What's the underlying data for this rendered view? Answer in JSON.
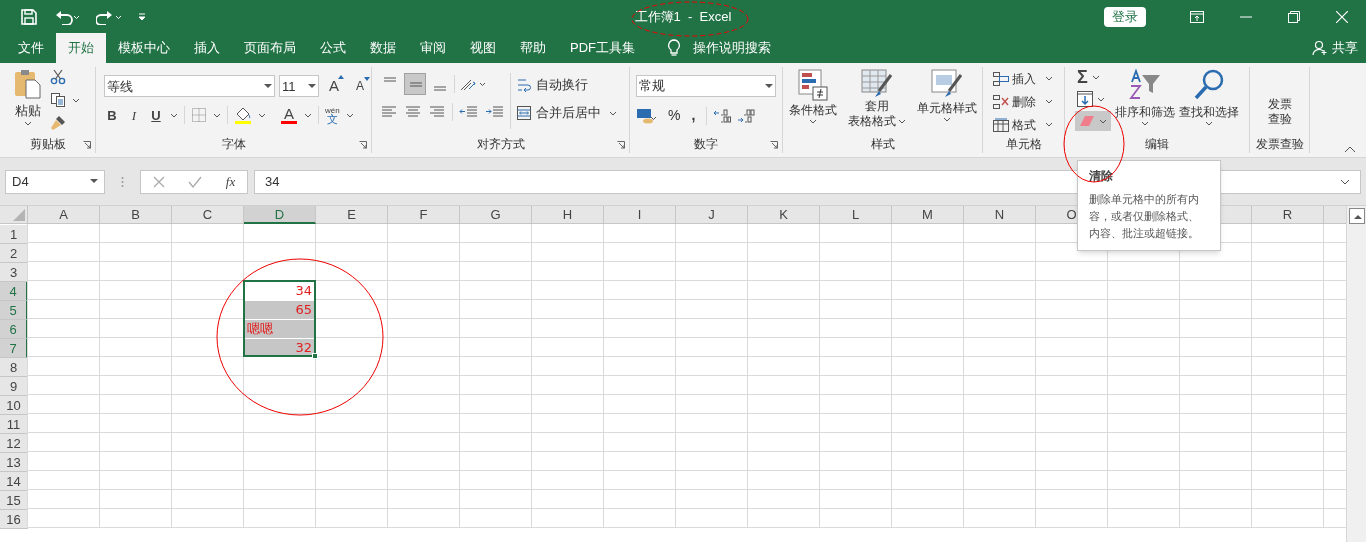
{
  "window": {
    "title": "工作簿1  -  Excel",
    "sign_in": "登录"
  },
  "tabs": [
    {
      "label": "文件",
      "selected": false
    },
    {
      "label": "开始",
      "selected": true
    },
    {
      "label": "模板中心",
      "selected": false
    },
    {
      "label": "插入",
      "selected": false
    },
    {
      "label": "页面布局",
      "selected": false
    },
    {
      "label": "公式",
      "selected": false
    },
    {
      "label": "数据",
      "selected": false
    },
    {
      "label": "审阅",
      "selected": false
    },
    {
      "label": "视图",
      "selected": false
    },
    {
      "label": "帮助",
      "selected": false
    },
    {
      "label": "PDF工具集",
      "selected": false
    }
  ],
  "tell_me": "操作说明搜索",
  "share": "共享",
  "ribbon": {
    "clipboard": {
      "paste": "粘贴",
      "label": "剪贴板"
    },
    "font": {
      "font_name": "等线",
      "font_size": "11",
      "grow": "A",
      "shrink": "A",
      "bold": "B",
      "italic": "I",
      "underline": "U",
      "font_color": "A",
      "phonetic_top": "wén",
      "phonetic_bottom": "文",
      "label": "字体"
    },
    "alignment": {
      "wrap_text": "自动换行",
      "merge_center": "合并后居中",
      "label": "对齐方式"
    },
    "number": {
      "format": "常规",
      "percent": "%",
      "comma": ",",
      "label": "数字"
    },
    "styles": {
      "conditional": "条件格式",
      "table_top": "套用",
      "table_bottom": "表格格式",
      "cell_styles": "单元格样式",
      "label": "样式"
    },
    "cells": {
      "insert": "插入",
      "delete": "删除",
      "format": "格式",
      "label": "单元格"
    },
    "editing": {
      "autosum": "Σ",
      "clear_hovered": true,
      "sort": "排序和筛选",
      "find": "查找和选择",
      "label": "编辑"
    },
    "invoice": {
      "top": "发票",
      "bottom": "查验",
      "label": "发票查验"
    }
  },
  "formula_bar": {
    "name_box": "D4",
    "function_label": "fx",
    "value": "34"
  },
  "sheet": {
    "columns": [
      {
        "label": "A",
        "selected": false
      },
      {
        "label": "B",
        "selected": false
      },
      {
        "label": "C",
        "selected": false
      },
      {
        "label": "D",
        "selected": true
      },
      {
        "label": "E",
        "selected": false
      },
      {
        "label": "F",
        "selected": false
      },
      {
        "label": "G",
        "selected": false
      },
      {
        "label": "H",
        "selected": false
      },
      {
        "label": "I",
        "selected": false
      },
      {
        "label": "J",
        "selected": false
      },
      {
        "label": "K",
        "selected": false
      },
      {
        "label": "L",
        "selected": false
      },
      {
        "label": "M",
        "selected": false
      },
      {
        "label": "N",
        "selected": false
      },
      {
        "label": "O",
        "selected": false
      },
      {},
      {
        "selected": false
      },
      {
        "label": "R",
        "selected": false
      }
    ],
    "rows": [
      {
        "label": "1",
        "selected": false
      },
      {
        "label": "2",
        "selected": false
      },
      {
        "label": "3",
        "selected": false
      },
      {
        "label": "4",
        "selected": true,
        "cells": [
          null,
          null,
          null,
          {
            "value": "34",
            "kind": "number",
            "active": true,
            "selected": true
          }
        ]
      },
      {
        "label": "5",
        "selected": true,
        "cells": [
          null,
          null,
          null,
          {
            "value": "65",
            "kind": "number",
            "active": false,
            "selected": true
          }
        ]
      },
      {
        "label": "6",
        "selected": true,
        "cells": [
          null,
          null,
          null,
          {
            "value": "嗯嗯",
            "kind": "text",
            "active": false,
            "selected": true
          }
        ]
      },
      {
        "label": "7",
        "selected": true,
        "cells": [
          null,
          null,
          null,
          {
            "value": "32",
            "kind": "number",
            "active": false,
            "selected": true
          }
        ]
      },
      {
        "label": "8",
        "selected": false
      },
      {
        "label": "9",
        "selected": false
      },
      {
        "label": "10",
        "selected": false
      },
      {
        "label": "11",
        "selected": false
      },
      {
        "label": "12",
        "selected": false
      },
      {
        "label": "13",
        "selected": false
      },
      {
        "label": "14",
        "selected": false
      },
      {
        "label": "15",
        "selected": false
      },
      {
        "label": "16",
        "selected": false
      }
    ]
  },
  "tooltip": {
    "title": "清除",
    "body": "删除单元格中的所有内容，或者仅删除格式、内容、批注或超链接。"
  }
}
